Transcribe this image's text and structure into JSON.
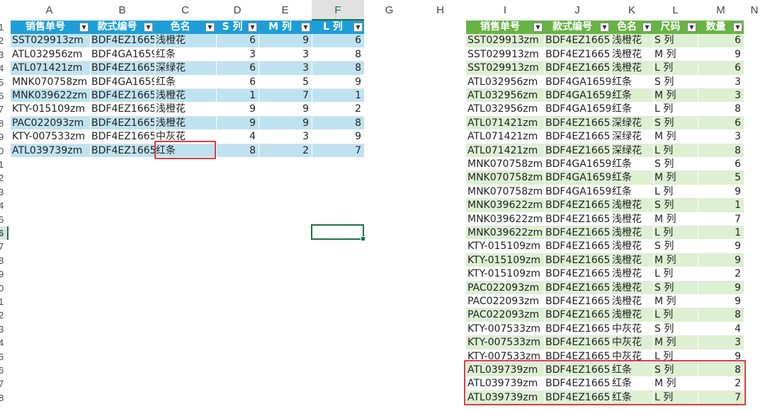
{
  "columns": [
    "A",
    "B",
    "C",
    "D",
    "E",
    "F",
    "G",
    "H",
    "I",
    "J",
    "K",
    "L",
    "M",
    "N"
  ],
  "selected_column": "F",
  "row_numbers": [
    "1",
    "2",
    "3",
    "4",
    "5",
    "6",
    "7",
    "8",
    "9",
    "0",
    "1",
    "2",
    "3",
    "4",
    "5",
    "6",
    "7",
    "8",
    "9",
    "0",
    "1",
    "2",
    "3",
    "4",
    "5",
    "6",
    "7",
    "8"
  ],
  "selected_row_index": 15,
  "left_table": {
    "headers": [
      "销售单号",
      "款式编号",
      "色名",
      "S 列",
      "M 列",
      "L 列"
    ],
    "rows": [
      [
        "SST029913zm",
        "BDF4EZ1665",
        "浅橙花",
        "6",
        "9",
        "6"
      ],
      [
        "ATL032956zm",
        "BDF4GA1659",
        "红条",
        "3",
        "3",
        "8"
      ],
      [
        "ATL071421zm",
        "BDF4EZ1665",
        "深绿花",
        "6",
        "3",
        "8"
      ],
      [
        "MNK070758zm",
        "BDF4GA1659",
        "红条",
        "6",
        "5",
        "9"
      ],
      [
        "MNK039622zm",
        "BDF4EZ1665",
        "浅橙花",
        "1",
        "7",
        "1"
      ],
      [
        "KTY-015109zm",
        "BDF4EZ1665",
        "浅橙花",
        "9",
        "9",
        "2"
      ],
      [
        "PAC022093zm",
        "BDF4EZ1665",
        "浅橙花",
        "9",
        "9",
        "8"
      ],
      [
        "KTY-007533zm",
        "BDF4EZ1665",
        "中灰花",
        "4",
        "3",
        "9"
      ],
      [
        "ATL039739zm",
        "BDF4EZ1665",
        "红条",
        "8",
        "2",
        "7"
      ]
    ]
  },
  "right_table": {
    "headers": [
      "销售单号",
      "款式编号",
      "色名",
      "尺码",
      "数量"
    ],
    "rows": [
      [
        "SST029913zm",
        "BDF4EZ1665",
        "浅橙花",
        "S 列",
        "6"
      ],
      [
        "SST029913zm",
        "BDF4EZ1665",
        "浅橙花",
        "M 列",
        "9"
      ],
      [
        "SST029913zm",
        "BDF4EZ1665",
        "浅橙花",
        "L 列",
        "6"
      ],
      [
        "ATL032956zm",
        "BDF4GA1659",
        "红条",
        "S 列",
        "3"
      ],
      [
        "ATL032956zm",
        "BDF4GA1659",
        "红条",
        "M 列",
        "3"
      ],
      [
        "ATL032956zm",
        "BDF4GA1659",
        "红条",
        "L 列",
        "8"
      ],
      [
        "ATL071421zm",
        "BDF4EZ1665",
        "深绿花",
        "S 列",
        "6"
      ],
      [
        "ATL071421zm",
        "BDF4EZ1665",
        "深绿花",
        "M 列",
        "3"
      ],
      [
        "ATL071421zm",
        "BDF4EZ1665",
        "深绿花",
        "L 列",
        "8"
      ],
      [
        "MNK070758zm",
        "BDF4GA1659",
        "红条",
        "S 列",
        "6"
      ],
      [
        "MNK070758zm",
        "BDF4GA1659",
        "红条",
        "M 列",
        "5"
      ],
      [
        "MNK070758zm",
        "BDF4GA1659",
        "红条",
        "L 列",
        "9"
      ],
      [
        "MNK039622zm",
        "BDF4EZ1665",
        "浅橙花",
        "S 列",
        "1"
      ],
      [
        "MNK039622zm",
        "BDF4EZ1665",
        "浅橙花",
        "M 列",
        "7"
      ],
      [
        "MNK039622zm",
        "BDF4EZ1665",
        "浅橙花",
        "L 列",
        "1"
      ],
      [
        "KTY-015109zm",
        "BDF4EZ1665",
        "浅橙花",
        "S 列",
        "9"
      ],
      [
        "KTY-015109zm",
        "BDF4EZ1665",
        "浅橙花",
        "M 列",
        "9"
      ],
      [
        "KTY-015109zm",
        "BDF4EZ1665",
        "浅橙花",
        "L 列",
        "2"
      ],
      [
        "PAC022093zm",
        "BDF4EZ1665",
        "浅橙花",
        "S 列",
        "9"
      ],
      [
        "PAC022093zm",
        "BDF4EZ1665",
        "浅橙花",
        "M 列",
        "9"
      ],
      [
        "PAC022093zm",
        "BDF4EZ1665",
        "浅橙花",
        "L 列",
        "8"
      ],
      [
        "KTY-007533zm",
        "BDF4EZ1665",
        "中灰花",
        "S 列",
        "4"
      ],
      [
        "KTY-007533zm",
        "BDF4EZ1665",
        "中灰花",
        "M 列",
        "3"
      ],
      [
        "KTY-007533zm",
        "BDF4EZ1665",
        "中灰花",
        "L 列",
        "9"
      ],
      [
        "ATL039739zm",
        "BDF4EZ1665",
        "红条",
        "S 列",
        "8"
      ],
      [
        "ATL039739zm",
        "BDF4EZ1665",
        "红条",
        "M 列",
        "2"
      ],
      [
        "ATL039739zm",
        "BDF4EZ1665",
        "红条",
        "L 列",
        "7"
      ]
    ]
  },
  "icons": {
    "filter_dropdown": "dropdown-arrow-icon"
  },
  "colors": {
    "left_header": "#1e9ed8",
    "left_band": "#bfe2f1",
    "right_header": "#67b345",
    "right_band": "#ddf0d2",
    "highlight_border": "#e0393e",
    "selection": "#1f7145"
  }
}
